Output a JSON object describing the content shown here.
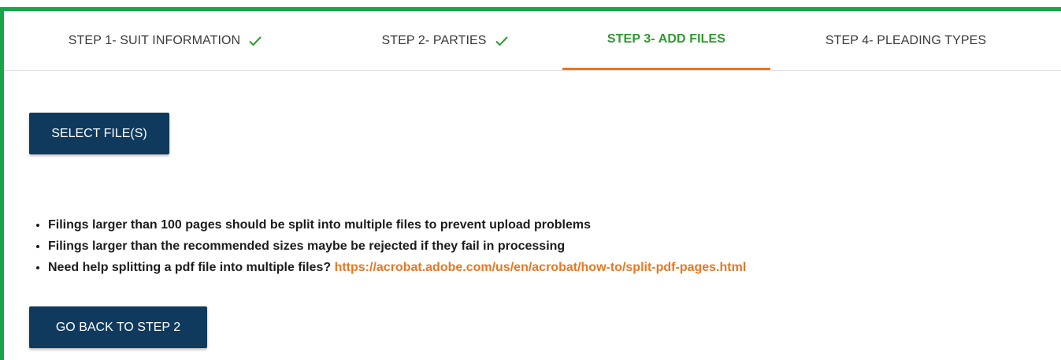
{
  "tabs": [
    {
      "label": "STEP 1- SUIT INFORMATION",
      "completed": true,
      "active": false
    },
    {
      "label": "STEP 2- PARTIES",
      "completed": true,
      "active": false
    },
    {
      "label": "STEP 3- ADD FILES",
      "completed": false,
      "active": true
    },
    {
      "label": "STEP 4- PLEADING TYPES",
      "completed": false,
      "active": false
    }
  ],
  "actions": {
    "select_files_label": "SELECT FILE(S)",
    "go_back_label": "GO BACK TO STEP 2"
  },
  "notes": {
    "item1": "Filings larger than 100 pages should be split into multiple files to prevent upload problems",
    "item2": "Filings larger than the recommended sizes maybe be rejected if they fail in processing",
    "item3_text": "Need help splitting a pdf file into multiple files?",
    "item3_link": "https://acrobat.adobe.com/us/en/acrobat/how-to/split-pdf-pages.html"
  },
  "colors": {
    "frame_border": "#1aa54a",
    "active_tab_text": "#2e9a2e",
    "active_tab_underline": "#e87722",
    "button_bg": "#0f3a5e",
    "link": "#e87722",
    "check": "#2e9a2e"
  },
  "icons": {
    "completed": "check-icon"
  }
}
